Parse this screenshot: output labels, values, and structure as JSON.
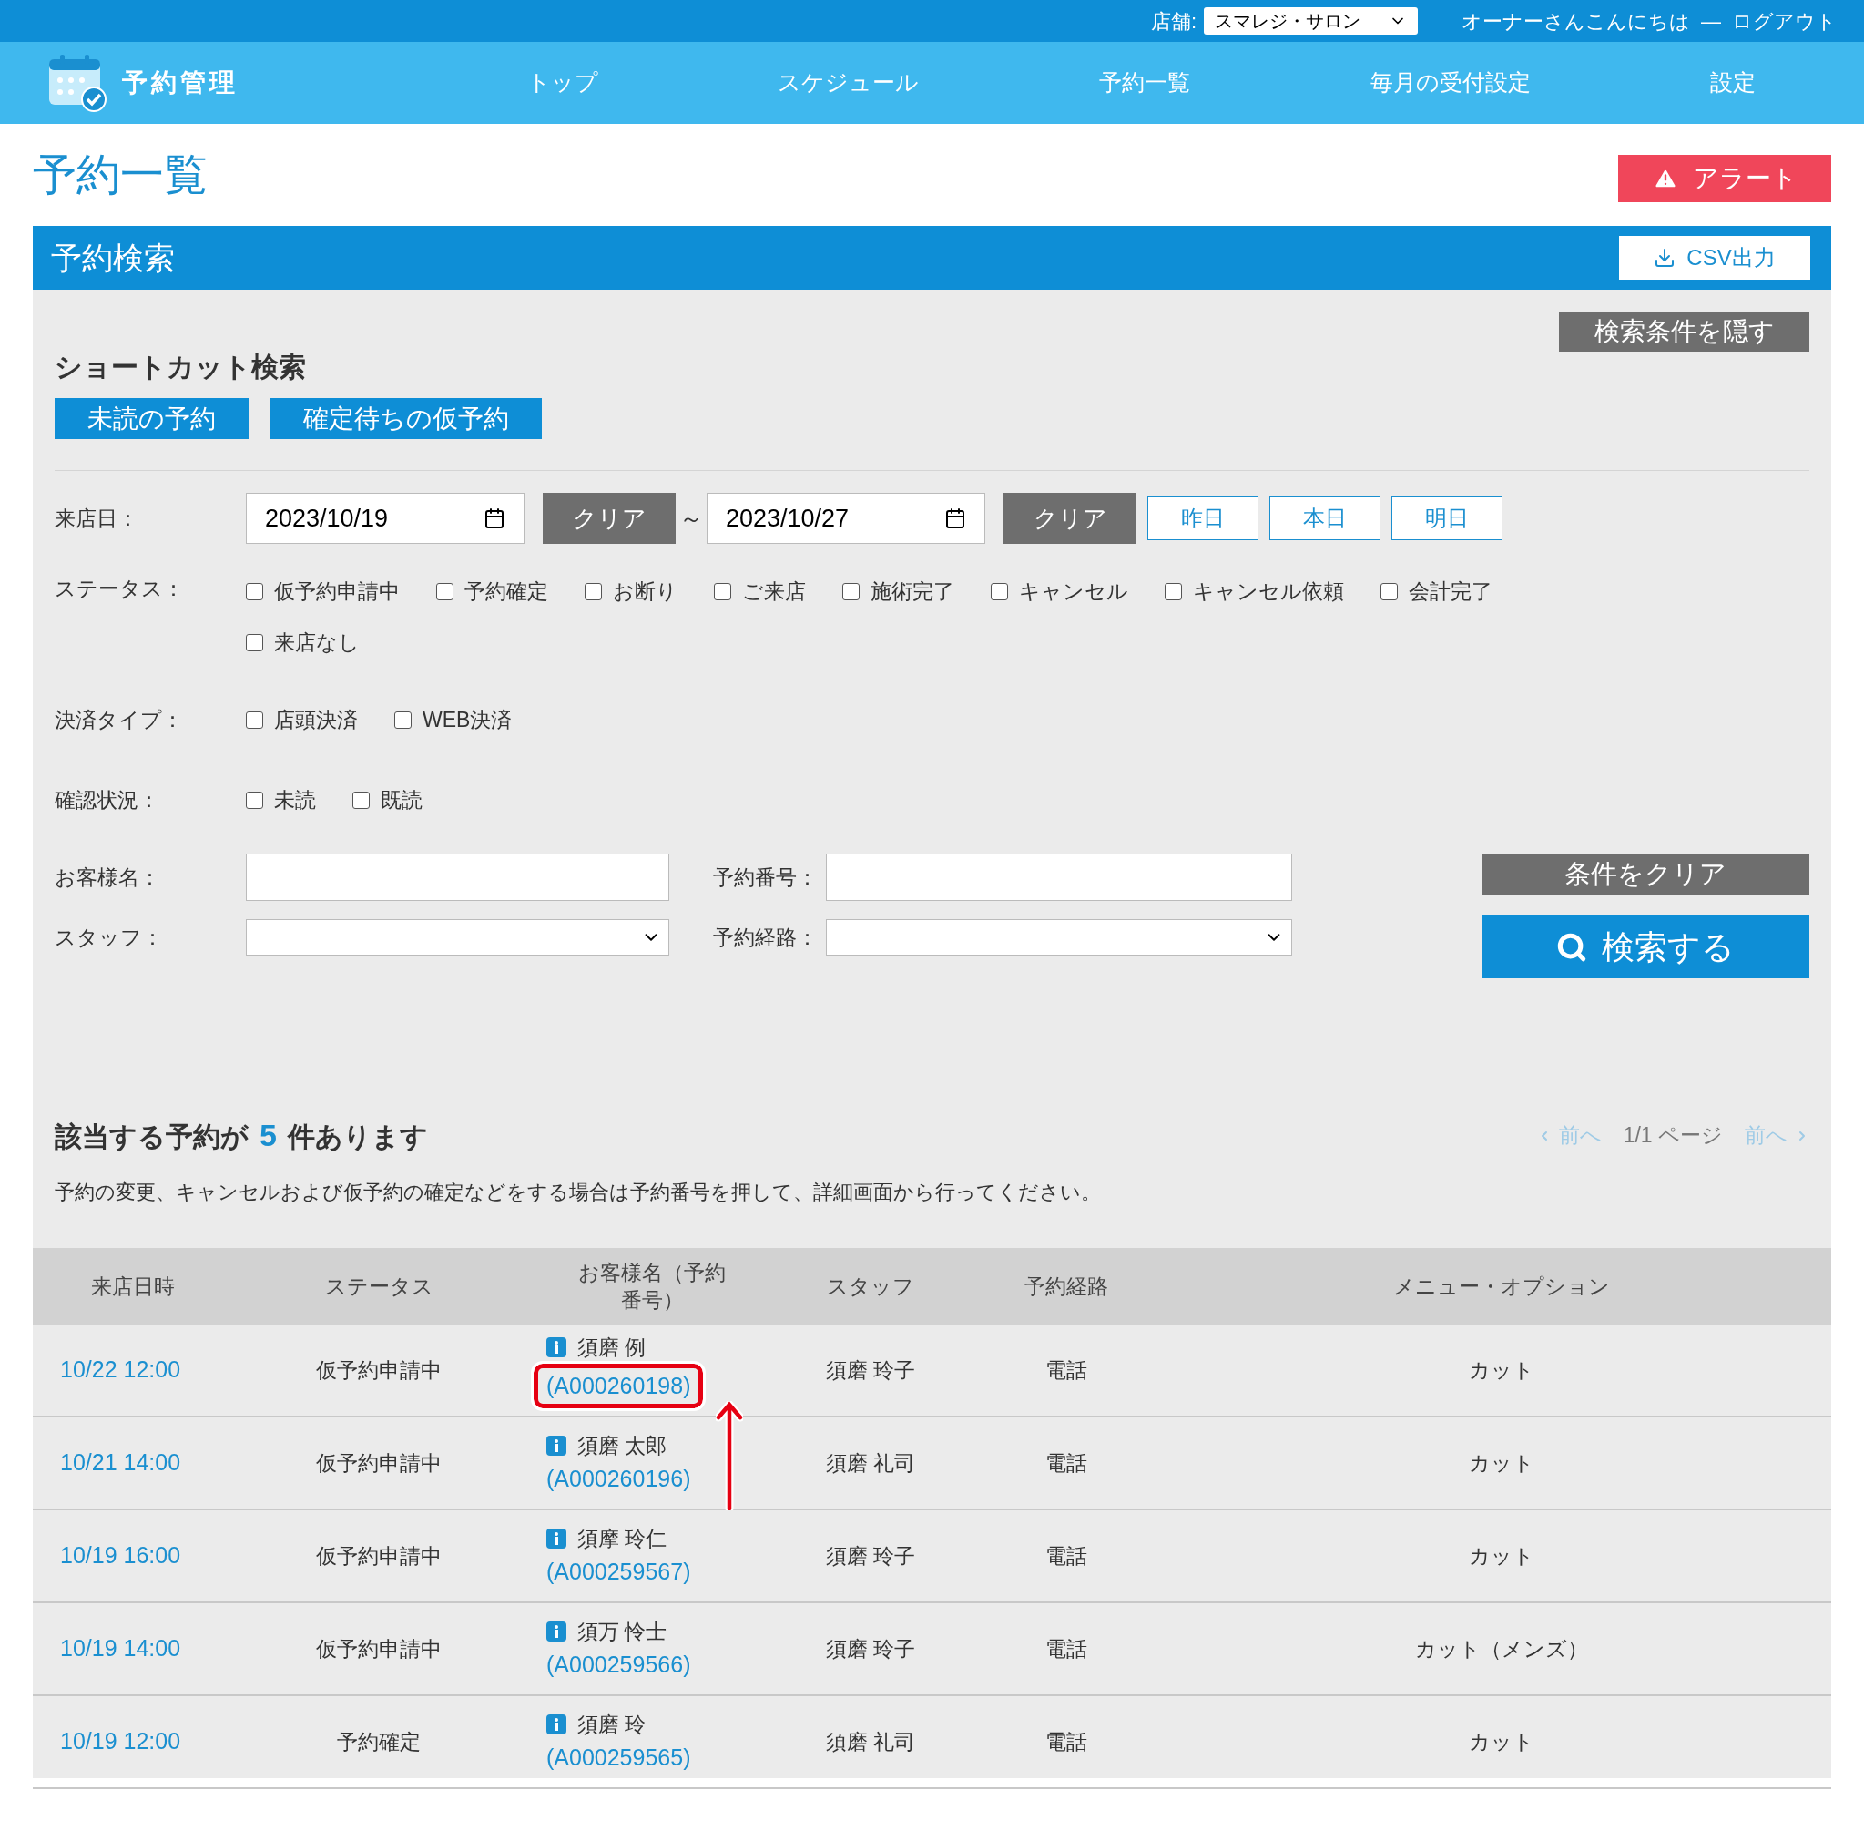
{
  "top_bar": {
    "store_label": "店舗:",
    "store_value": "スマレジ・サロン",
    "greeting": "オーナーさんこんにちは",
    "separator": "—",
    "logout": "ログアウト"
  },
  "nav": {
    "brand": "予約管理",
    "items": [
      {
        "label": "トップ"
      },
      {
        "label": "スケジュール"
      },
      {
        "label": "予約一覧"
      },
      {
        "label": "毎月の受付設定"
      },
      {
        "label": "設定"
      }
    ]
  },
  "page_title": "予約一覧",
  "alert_button": "アラート",
  "section": {
    "title": "予約検索",
    "csv_button": "CSV出力"
  },
  "search": {
    "hide_button": "検索条件を隠す",
    "shortcut_title": "ショートカット検索",
    "shortcuts": [
      "未読の予約",
      "確定待ちの仮予約"
    ],
    "visit_date": {
      "label": "来店日：",
      "from": "2023/10/19",
      "clear1": "クリア",
      "tilde": "～",
      "to": "2023/10/27",
      "clear2": "クリア",
      "quick": [
        "昨日",
        "本日",
        "明日"
      ]
    },
    "status": {
      "label": "ステータス：",
      "options": [
        {
          "label": "仮予約申請中",
          "checked": false
        },
        {
          "label": "予約確定",
          "checked": false
        },
        {
          "label": "お断り",
          "checked": false
        },
        {
          "label": "ご来店",
          "checked": false
        },
        {
          "label": "施術完了",
          "checked": false
        },
        {
          "label": "キャンセル",
          "checked": false
        },
        {
          "label": "キャンセル依頼",
          "checked": false
        },
        {
          "label": "会計完了",
          "checked": false
        },
        {
          "label": "来店なし",
          "checked": false
        }
      ]
    },
    "payment": {
      "label": "決済タイプ：",
      "options": [
        {
          "label": "店頭決済",
          "checked": false
        },
        {
          "label": "WEB決済",
          "checked": false
        }
      ]
    },
    "confirmation": {
      "label": "確認状況：",
      "options": [
        {
          "label": "未読",
          "checked": false
        },
        {
          "label": "既読",
          "checked": false
        }
      ]
    },
    "customer_label": "お客様名：",
    "number_label": "予約番号：",
    "staff_label": "スタッフ：",
    "route_label": "予約経路：",
    "clear_button": "条件をクリア",
    "search_button": "検索する"
  },
  "results": {
    "heading_before": "該当する予約が",
    "count": "5",
    "heading_after": "件あります",
    "pager": {
      "prev": "前へ",
      "page": "1/1 ページ",
      "next": "前へ",
      "prev_disabled": true,
      "next_disabled": true
    },
    "note": "予約の変更、キャンセルおよび仮予約の確定などをする場合は予約番号を押して、詳細画面から行ってください。"
  },
  "table": {
    "columns": [
      "来店日時",
      "ステータス",
      "お客様名（予約番号）",
      "スタッフ",
      "予約経路",
      "メニュー・オプション"
    ],
    "rows": [
      {
        "datetime": "10/22 12:00",
        "status": "仮予約申請中",
        "name": "須磨 例",
        "number": "(A000260198)",
        "staff": "須磨 玲子",
        "route": "電話",
        "menu": "カット",
        "highlighted": true
      },
      {
        "datetime": "10/21 14:00",
        "status": "仮予約申請中",
        "name": "須磨 太郎",
        "number": "(A000260196)",
        "staff": "須磨 礼司",
        "route": "電話",
        "menu": "カット",
        "highlighted": false
      },
      {
        "datetime": "10/19 16:00",
        "status": "仮予約申請中",
        "name": "須摩 玲仁",
        "number": "(A000259567)",
        "staff": "須磨 玲子",
        "route": "電話",
        "menu": "カット",
        "highlighted": false
      },
      {
        "datetime": "10/19 14:00",
        "status": "仮予約申請中",
        "name": "須万 怜士",
        "number": "(A000259566)",
        "staff": "須磨 玲子",
        "route": "電話",
        "menu": "カット（メンズ）",
        "highlighted": false
      },
      {
        "datetime": "10/19 12:00",
        "status": "予約確定",
        "name": "須磨 玲",
        "number": "(A000259565)",
        "staff": "須磨 礼司",
        "route": "電話",
        "menu": "カット",
        "highlighted": false
      }
    ]
  }
}
